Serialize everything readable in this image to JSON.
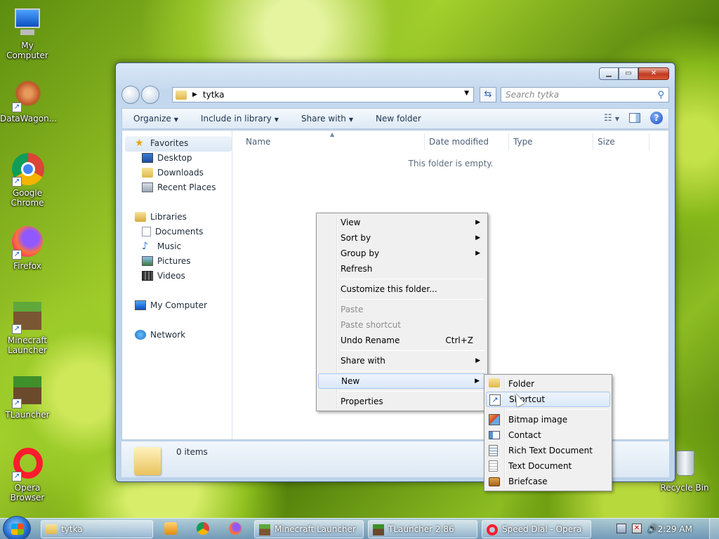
{
  "desktop": {
    "icons": [
      {
        "label": "My Computer",
        "icon": "computer-icon"
      },
      {
        "label": "DataWagon...",
        "icon": "datawagon-icon"
      },
      {
        "label": "Google\nChrome",
        "icon": "chrome-icon"
      },
      {
        "label": "Firefox",
        "icon": "firefox-icon"
      },
      {
        "label": "Minecraft\nLauncher",
        "icon": "minecraft-icon"
      },
      {
        "label": "TLauncher",
        "icon": "tlauncher-icon"
      },
      {
        "label": "Opera\nBrowser",
        "icon": "opera-icon"
      },
      {
        "label": "Recycle Bin",
        "icon": "recycle-bin-icon"
      }
    ]
  },
  "window": {
    "title_buttons": {
      "minimize": "▁",
      "maximize": "▭",
      "close": "✕"
    },
    "address": {
      "path": "tytka",
      "search_placeholder": "Search tytka"
    },
    "toolbar": {
      "organize": "Organize",
      "include": "Include in library",
      "share": "Share with",
      "new_folder": "New folder",
      "help": "?"
    },
    "nav": {
      "favorites": "Favorites",
      "desktop": "Desktop",
      "downloads": "Downloads",
      "recent": "Recent Places",
      "libraries": "Libraries",
      "documents": "Documents",
      "music": "Music",
      "pictures": "Pictures",
      "videos": "Videos",
      "computer": "My Computer",
      "network": "Network"
    },
    "columns": {
      "name": "Name",
      "date": "Date modified",
      "type": "Type",
      "size": "Size"
    },
    "empty_message": "This folder is empty.",
    "details": {
      "count": "0 items"
    }
  },
  "context_menu": {
    "view": "View",
    "sort_by": "Sort by",
    "group_by": "Group by",
    "refresh": "Refresh",
    "customize": "Customize this folder...",
    "paste": "Paste",
    "paste_shortcut": "Paste shortcut",
    "undo_rename": "Undo Rename",
    "undo_key": "Ctrl+Z",
    "share_with": "Share with",
    "new": "New",
    "properties": "Properties"
  },
  "new_submenu": {
    "folder": "Folder",
    "shortcut": "Shortcut",
    "bitmap": "Bitmap image",
    "contact": "Contact",
    "rtf": "Rich Text Document",
    "text": "Text Document",
    "briefcase": "Briefcase"
  },
  "taskbar": {
    "items": {
      "explorer": "tytka",
      "minecraft": "Minecraft Launcher",
      "tlauncher": "TLauncher 2.86",
      "opera": "Speed Dial - Opera"
    },
    "clock": "2:29 AM"
  },
  "colors": {
    "accent": "#1e3550",
    "menu_highlight": "#dbe8f8",
    "close_button": "#c0391f"
  }
}
